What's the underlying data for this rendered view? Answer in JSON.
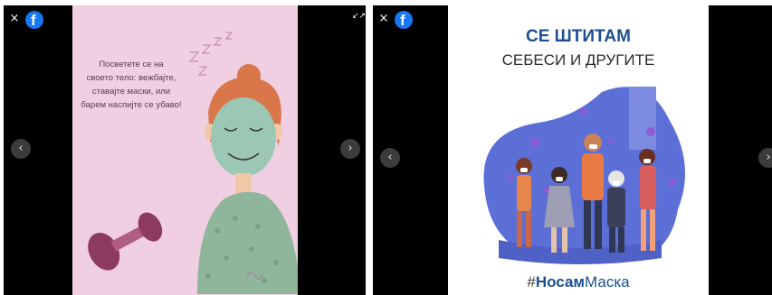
{
  "viewers": [
    {
      "controls": {
        "close_icon": "×",
        "facebook_icon": "f",
        "expand_icon": "↙↗",
        "prev_icon": "‹",
        "next_icon": "›"
      },
      "slide": {
        "caption_lines": [
          "Посветете се на",
          "своето тело: вежбајте,",
          "ставајте маски, или",
          "барем наспијте се убаво!"
        ],
        "sleep_letters": "Z Z Z Z",
        "colors": {
          "background": "#f1cfe2",
          "mask": "#9cc7b5",
          "hair": "#d9774a",
          "dumbbell": "#8c3a5e"
        }
      }
    },
    {
      "controls": {
        "close_icon": "×",
        "facebook_icon": "f",
        "prev_icon": "‹",
        "next_icon": "›"
      },
      "slide": {
        "title_bold": "СЕ ШТИТАМ",
        "title_regular": "СЕБЕСИ И ДРУГИТЕ",
        "hashtag_prefix": "#",
        "hashtag_bold": "Носам",
        "hashtag_regular": "Маска",
        "colors": {
          "blob": "#5b6fd6",
          "title": "#1d4f8f",
          "virus": "#8f5ad6"
        }
      }
    }
  ]
}
